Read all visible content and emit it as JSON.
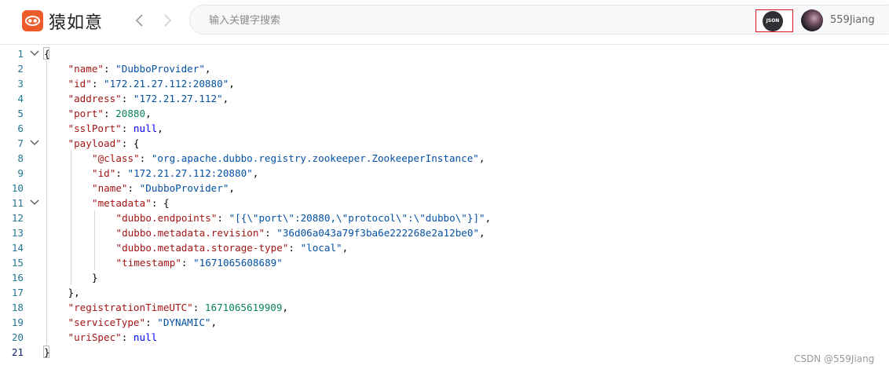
{
  "app": {
    "name": "猿如意",
    "brand_color": "#ee5a2a"
  },
  "nav": {
    "back_icon": "chevron-left-icon",
    "forward_icon": "chevron-right-icon"
  },
  "search": {
    "placeholder": "输入关键字搜索",
    "value": ""
  },
  "json_tool": {
    "label": "JSON",
    "highlight_color": "#e0161b"
  },
  "user": {
    "name": "559Jiang"
  },
  "watermark": "CSDN @559Jiang",
  "editor": {
    "lines": [
      {
        "no": "1",
        "indent": 0,
        "fold": true,
        "tokens": [
          {
            "t": "p",
            "v": "{"
          }
        ]
      },
      {
        "no": "2",
        "indent": 1,
        "fold": false,
        "tokens": [
          {
            "t": "k",
            "v": "\"name\""
          },
          {
            "t": "p",
            "v": ": "
          },
          {
            "t": "s",
            "v": "\"DubboProvider\""
          },
          {
            "t": "p",
            "v": ","
          }
        ]
      },
      {
        "no": "3",
        "indent": 1,
        "fold": false,
        "tokens": [
          {
            "t": "k",
            "v": "\"id\""
          },
          {
            "t": "p",
            "v": ": "
          },
          {
            "t": "s",
            "v": "\"172.21.27.112:20880\""
          },
          {
            "t": "p",
            "v": ","
          }
        ]
      },
      {
        "no": "4",
        "indent": 1,
        "fold": false,
        "tokens": [
          {
            "t": "k",
            "v": "\"address\""
          },
          {
            "t": "p",
            "v": ": "
          },
          {
            "t": "s",
            "v": "\"172.21.27.112\""
          },
          {
            "t": "p",
            "v": ","
          }
        ]
      },
      {
        "no": "5",
        "indent": 1,
        "fold": false,
        "tokens": [
          {
            "t": "k",
            "v": "\"port\""
          },
          {
            "t": "p",
            "v": ": "
          },
          {
            "t": "n",
            "v": "20880"
          },
          {
            "t": "p",
            "v": ","
          }
        ]
      },
      {
        "no": "6",
        "indent": 1,
        "fold": false,
        "tokens": [
          {
            "t": "k",
            "v": "\"sslPort\""
          },
          {
            "t": "p",
            "v": ": "
          },
          {
            "t": "kw",
            "v": "null"
          },
          {
            "t": "p",
            "v": ","
          }
        ]
      },
      {
        "no": "7",
        "indent": 1,
        "fold": true,
        "tokens": [
          {
            "t": "k",
            "v": "\"payload\""
          },
          {
            "t": "p",
            "v": ": {"
          }
        ]
      },
      {
        "no": "8",
        "indent": 2,
        "fold": false,
        "tokens": [
          {
            "t": "k",
            "v": "\"@class\""
          },
          {
            "t": "p",
            "v": ": "
          },
          {
            "t": "s",
            "v": "\"org.apache.dubbo.registry.zookeeper.ZookeeperInstance\""
          },
          {
            "t": "p",
            "v": ","
          }
        ]
      },
      {
        "no": "9",
        "indent": 2,
        "fold": false,
        "tokens": [
          {
            "t": "k",
            "v": "\"id\""
          },
          {
            "t": "p",
            "v": ": "
          },
          {
            "t": "s",
            "v": "\"172.21.27.112:20880\""
          },
          {
            "t": "p",
            "v": ","
          }
        ]
      },
      {
        "no": "10",
        "indent": 2,
        "fold": false,
        "tokens": [
          {
            "t": "k",
            "v": "\"name\""
          },
          {
            "t": "p",
            "v": ": "
          },
          {
            "t": "s",
            "v": "\"DubboProvider\""
          },
          {
            "t": "p",
            "v": ","
          }
        ]
      },
      {
        "no": "11",
        "indent": 2,
        "fold": true,
        "tokens": [
          {
            "t": "k",
            "v": "\"metadata\""
          },
          {
            "t": "p",
            "v": ": {"
          }
        ]
      },
      {
        "no": "12",
        "indent": 3,
        "fold": false,
        "tokens": [
          {
            "t": "k",
            "v": "\"dubbo.endpoints\""
          },
          {
            "t": "p",
            "v": ": "
          },
          {
            "t": "s",
            "v": "\"[{\\\"port\\\":20880,\\\"protocol\\\":\\\"dubbo\\\"}]\""
          },
          {
            "t": "p",
            "v": ","
          }
        ]
      },
      {
        "no": "13",
        "indent": 3,
        "fold": false,
        "tokens": [
          {
            "t": "k",
            "v": "\"dubbo.metadata.revision\""
          },
          {
            "t": "p",
            "v": ": "
          },
          {
            "t": "s",
            "v": "\"36d06a043a79f3ba6e222268e2a12be0\""
          },
          {
            "t": "p",
            "v": ","
          }
        ]
      },
      {
        "no": "14",
        "indent": 3,
        "fold": false,
        "tokens": [
          {
            "t": "k",
            "v": "\"dubbo.metadata.storage-type\""
          },
          {
            "t": "p",
            "v": ": "
          },
          {
            "t": "s",
            "v": "\"local\""
          },
          {
            "t": "p",
            "v": ","
          }
        ]
      },
      {
        "no": "15",
        "indent": 3,
        "fold": false,
        "tokens": [
          {
            "t": "k",
            "v": "\"timestamp\""
          },
          {
            "t": "p",
            "v": ": "
          },
          {
            "t": "s",
            "v": "\"1671065608689\""
          }
        ]
      },
      {
        "no": "16",
        "indent": 2,
        "fold": false,
        "tokens": [
          {
            "t": "p",
            "v": "}"
          }
        ]
      },
      {
        "no": "17",
        "indent": 1,
        "fold": false,
        "tokens": [
          {
            "t": "p",
            "v": "},"
          }
        ]
      },
      {
        "no": "18",
        "indent": 1,
        "fold": false,
        "tokens": [
          {
            "t": "k",
            "v": "\"registrationTimeUTC\""
          },
          {
            "t": "p",
            "v": ": "
          },
          {
            "t": "n",
            "v": "1671065619909"
          },
          {
            "t": "p",
            "v": ","
          }
        ]
      },
      {
        "no": "19",
        "indent": 1,
        "fold": false,
        "tokens": [
          {
            "t": "k",
            "v": "\"serviceType\""
          },
          {
            "t": "p",
            "v": ": "
          },
          {
            "t": "s",
            "v": "\"DYNAMIC\""
          },
          {
            "t": "p",
            "v": ","
          }
        ]
      },
      {
        "no": "20",
        "indent": 1,
        "fold": false,
        "tokens": [
          {
            "t": "k",
            "v": "\"uriSpec\""
          },
          {
            "t": "p",
            "v": ": "
          },
          {
            "t": "kw",
            "v": "null"
          }
        ]
      },
      {
        "no": "21",
        "indent": 0,
        "fold": false,
        "current": true,
        "tokens": [
          {
            "t": "p",
            "v": "}"
          }
        ]
      }
    ]
  }
}
